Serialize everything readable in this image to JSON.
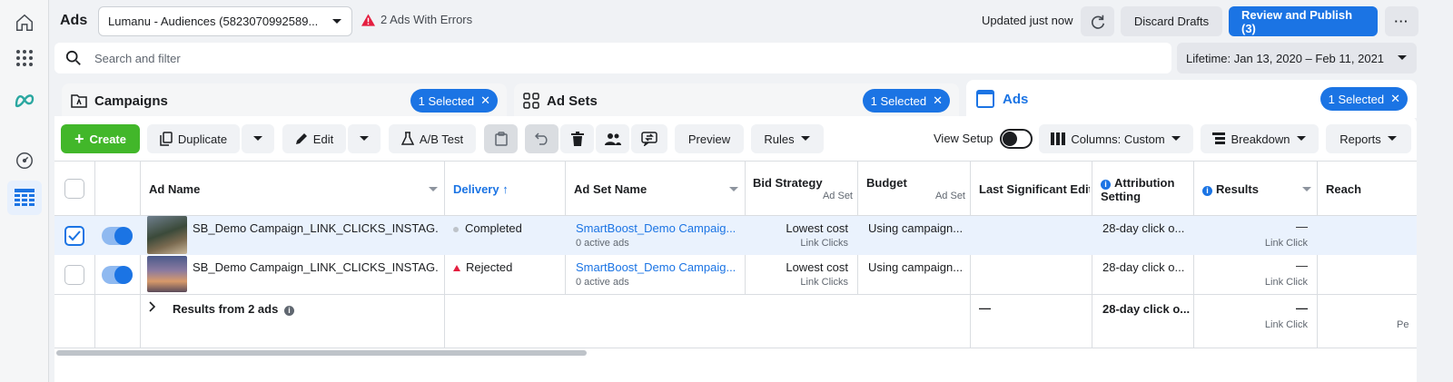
{
  "topbar": {
    "title": "Ads",
    "account": "Lumanu - Audiences (5823070992589...",
    "errors": "2 Ads With Errors",
    "updated": "Updated just now",
    "discard": "Discard Drafts",
    "publish": "Review and Publish (3)"
  },
  "search": {
    "placeholder": "Search and filter",
    "lifetime": "Lifetime: Jan 13, 2020 – Feb 11, 2021"
  },
  "tabs": [
    {
      "label": "Campaigns",
      "selected": "1 Selected"
    },
    {
      "label": "Ad Sets",
      "selected": "1 Selected"
    },
    {
      "label": "Ads",
      "selected": "1 Selected"
    }
  ],
  "toolbar": {
    "create": "Create",
    "duplicate": "Duplicate",
    "edit": "Edit",
    "ab_test": "A/B Test",
    "preview": "Preview",
    "rules": "Rules",
    "view_setup": "View Setup",
    "columns": "Columns: Custom",
    "breakdown": "Breakdown",
    "reports": "Reports"
  },
  "columns": {
    "ad_name": "Ad Name",
    "delivery": "Delivery",
    "ad_set_name": "Ad Set Name",
    "bid_strategy": "Bid Strategy",
    "bid_strategy_sub": "Ad Set",
    "budget": "Budget",
    "budget_sub": "Ad Set",
    "last_edit": "Last Significant Edit",
    "attribution": "Attribution",
    "attribution2": "Setting",
    "results": "Results",
    "reach": "Reach"
  },
  "rows": [
    {
      "name": "SB_Demo Campaign_LINK_CLICKS_INSTAG...",
      "delivery": "Completed",
      "adset": "SmartBoost_Demo Campaig...",
      "adset_sub": "0 active ads",
      "bid": "Lowest cost",
      "bid_sub": "Link Clicks",
      "budget": "Using campaign...",
      "attribution": "28-day click o...",
      "results": "—",
      "results_sub": "Link Click",
      "checked": true
    },
    {
      "name": "SB_Demo Campaign_LINK_CLICKS_INSTAG...",
      "delivery": "Rejected",
      "adset": "SmartBoost_Demo Campaig...",
      "adset_sub": "0 active ads",
      "bid": "Lowest cost",
      "bid_sub": "Link Clicks",
      "budget": "Using campaign...",
      "attribution": "28-day click o...",
      "results": "—",
      "results_sub": "Link Click",
      "checked": false
    }
  ],
  "summary": {
    "label": "Results from 2 ads",
    "last_edit": "—",
    "attribution": "28-day click o...",
    "results": "—",
    "results_sub": "Link Click",
    "reach_sub": "Pe"
  },
  "colors": {
    "accent": "#1b74e4",
    "create": "#42b72a",
    "error": "#e41e3f"
  }
}
